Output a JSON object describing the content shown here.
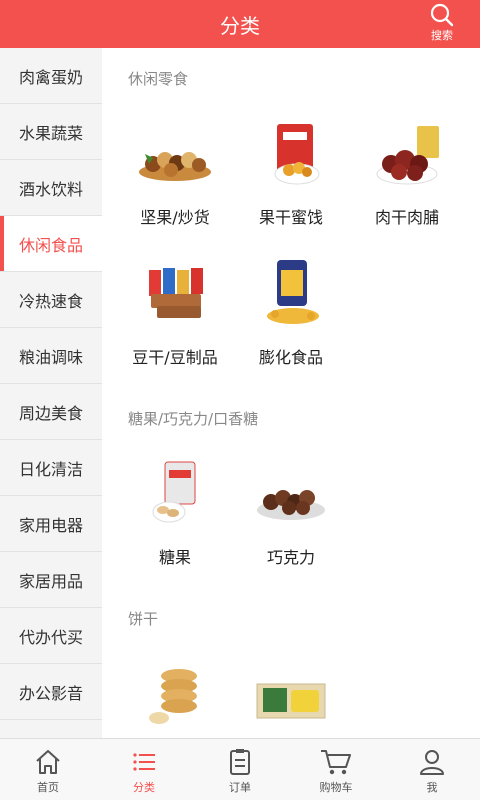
{
  "header": {
    "title": "分类",
    "search_label": "搜索"
  },
  "sidebar": {
    "items": [
      {
        "label": "肉禽蛋奶"
      },
      {
        "label": "水果蔬菜"
      },
      {
        "label": "酒水饮料"
      },
      {
        "label": "休闲食品",
        "active": true
      },
      {
        "label": "冷热速食"
      },
      {
        "label": "粮油调味"
      },
      {
        "label": "周边美食"
      },
      {
        "label": "日化清洁"
      },
      {
        "label": "家用电器"
      },
      {
        "label": "家居用品"
      },
      {
        "label": "代办代买"
      },
      {
        "label": "办公影音"
      },
      {
        "label": ""
      }
    ]
  },
  "sections": [
    {
      "title": "休闲零食",
      "items": [
        {
          "label": "坚果/炒货",
          "icon": "nuts-image"
        },
        {
          "label": "果干蜜饯",
          "icon": "dried-fruit-image"
        },
        {
          "label": "肉干肉脯",
          "icon": "jerky-image"
        },
        {
          "label": "豆干/豆制品",
          "icon": "tofu-snack-image"
        },
        {
          "label": "膨化食品",
          "icon": "puffed-snack-image"
        }
      ]
    },
    {
      "title": "糖果/巧克力/口香糖",
      "items": [
        {
          "label": "糖果",
          "icon": "candy-image"
        },
        {
          "label": "巧克力",
          "icon": "chocolate-image"
        }
      ]
    },
    {
      "title": "饼干",
      "items": [
        {
          "label": "",
          "icon": "biscuit-stack-image"
        },
        {
          "label": "",
          "icon": "cake-box-image"
        }
      ]
    }
  ],
  "tabbar": {
    "tabs": [
      {
        "label": "首页",
        "icon": "home-icon"
      },
      {
        "label": "分类",
        "icon": "list-icon",
        "active": true
      },
      {
        "label": "订单",
        "icon": "order-icon"
      },
      {
        "label": "购物车",
        "icon": "cart-icon"
      },
      {
        "label": "我",
        "icon": "user-icon"
      }
    ]
  },
  "colors": {
    "accent": "#f2514d",
    "sidebar_bg": "#f4f4f4",
    "section_title": "#888888"
  }
}
